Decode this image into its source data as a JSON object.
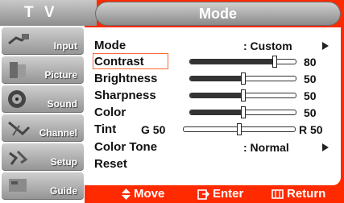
{
  "header": {
    "tv_label": "T V",
    "menu_title": "Mode"
  },
  "sidebar": {
    "items": [
      {
        "label": "Input",
        "icon": "input-plug-icon"
      },
      {
        "label": "Picture",
        "icon": "picture-icon"
      },
      {
        "label": "Sound",
        "icon": "speaker-icon"
      },
      {
        "label": "Channel",
        "icon": "channel-antenna-icon"
      },
      {
        "label": "Setup",
        "icon": "setup-satellite-icon"
      },
      {
        "label": "Guide",
        "icon": "guide-icon"
      }
    ]
  },
  "menu": {
    "mode": {
      "label": "Mode",
      "value": ": Custom"
    },
    "contrast": {
      "label": "Contrast",
      "value": "80",
      "level": 0.8
    },
    "brightness": {
      "label": "Brightness",
      "value": "50",
      "level": 0.5
    },
    "sharpness": {
      "label": "Sharpness",
      "value": "50",
      "level": 0.5
    },
    "color": {
      "label": "Color",
      "value": "50",
      "level": 0.5
    },
    "tint": {
      "label": "Tint",
      "left": "G 50",
      "right": "R 50",
      "level": 0.5
    },
    "color_tone": {
      "label": "Color Tone",
      "value": ": Normal"
    },
    "reset": {
      "label": "Reset"
    }
  },
  "footer": {
    "move": "Move",
    "enter": "Enter",
    "return": "Return"
  },
  "colors": {
    "background": "#ff2a00",
    "panel": "#ffffff",
    "highlight_frame": "#ff6a3a"
  }
}
